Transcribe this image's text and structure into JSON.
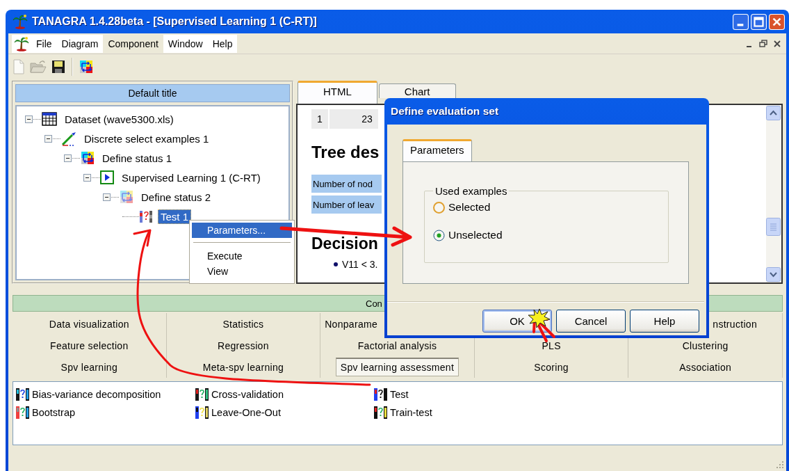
{
  "window": {
    "title": "TANAGRA 1.4.28beta - [Supervised Learning 1 (C-RT)]"
  },
  "menu": [
    {
      "label": "File",
      "selected": false
    },
    {
      "label": "Diagram",
      "selected": false
    },
    {
      "label": "Component",
      "selected": true
    },
    {
      "label": "Window",
      "selected": false
    },
    {
      "label": "Help",
      "selected": false
    }
  ],
  "toolbar": [
    {
      "kind": "new"
    },
    {
      "kind": "open"
    },
    {
      "kind": "save"
    },
    {
      "kind": "separator"
    },
    {
      "kind": "status"
    }
  ],
  "diagram": {
    "title": "Default title",
    "tree": [
      {
        "label": "Dataset (wave5300.xls)",
        "kind": "table",
        "expanded": true,
        "selected": false,
        "children": [
          {
            "label": "Discrete select examples 1",
            "kind": "pen",
            "expanded": true,
            "selected": false,
            "children": [
              {
                "label": "Define status 1",
                "kind": "arrows",
                "expanded": true,
                "selected": false,
                "children": [
                  {
                    "label": "Supervised Learning 1 (C-RT)",
                    "kind": "play",
                    "expanded": true,
                    "selected": false,
                    "children": [
                      {
                        "label": "Define status 2",
                        "kind": "arrows-faded",
                        "expanded": true,
                        "selected": false,
                        "children": [
                          {
                            "label": "Test 1",
                            "kind": "bars",
                            "selected": true
                          }
                        ]
                      }
                    ]
                  }
                ]
              }
            ]
          }
        ]
      }
    ]
  },
  "context_menu": [
    {
      "kind": "command",
      "label": "Parameters...",
      "selected": true
    },
    {
      "kind": "separator"
    },
    {
      "kind": "command",
      "label": "Execute",
      "selected": false
    },
    {
      "kind": "command",
      "label": "View",
      "selected": false
    }
  ],
  "viewer": {
    "tabs": [
      {
        "label": "HTML",
        "selected": true
      },
      {
        "label": "Chart",
        "selected": false
      }
    ],
    "index_cells": [
      "1",
      "23"
    ],
    "title": "Tree des",
    "stat_rows": [
      "Number of nod",
      "Number of leav"
    ],
    "section": "Decision",
    "rules": [
      "V11 < 3."
    ]
  },
  "dialog": {
    "title": "Define evaluation set",
    "tabs": [
      {
        "label": "Parameters",
        "selected": true
      }
    ],
    "group": {
      "label": "Used examples",
      "options": [
        {
          "label": "Selected",
          "selected": false
        },
        {
          "label": "Unselected",
          "selected": true
        }
      ]
    },
    "buttons": [
      "OK",
      "Cancel",
      "Help"
    ]
  },
  "components": {
    "title": "Con",
    "tabs": [
      [
        {
          "label": "Data visualization",
          "kind": "full",
          "selected": false
        },
        {
          "label": "Statistics",
          "kind": "full",
          "selected": false
        },
        {
          "label": "Nonparame",
          "kind": "cut-end",
          "selected": false
        },
        {
          "label": "nstruction",
          "kind": "cut-start",
          "selected": false
        }
      ],
      [
        {
          "label": "Feature selection",
          "kind": "full",
          "selected": false
        },
        {
          "label": "Regression",
          "kind": "full",
          "selected": false
        },
        {
          "label": "Factorial analysis",
          "kind": "full",
          "selected": false
        },
        {
          "label": "PLS",
          "kind": "full",
          "selected": false
        },
        {
          "label": "Clustering",
          "kind": "full",
          "selected": false
        }
      ],
      [
        {
          "label": "Spv learning",
          "kind": "full",
          "selected": false
        },
        {
          "label": "Meta-spv learning",
          "kind": "full",
          "selected": false
        },
        {
          "label": "Spv learning assessment",
          "kind": "full",
          "selected": true
        },
        {
          "label": "Scoring",
          "kind": "full",
          "selected": false
        },
        {
          "label": "Association",
          "kind": "full",
          "selected": false
        }
      ]
    ],
    "items": [
      {
        "label": "Bias-variance decomposition"
      },
      {
        "label": "Cross-validation"
      },
      {
        "label": "Test"
      },
      {
        "label": "Bootstrap"
      },
      {
        "label": "Leave-One-Out"
      },
      {
        "label": "Train-test"
      }
    ]
  }
}
